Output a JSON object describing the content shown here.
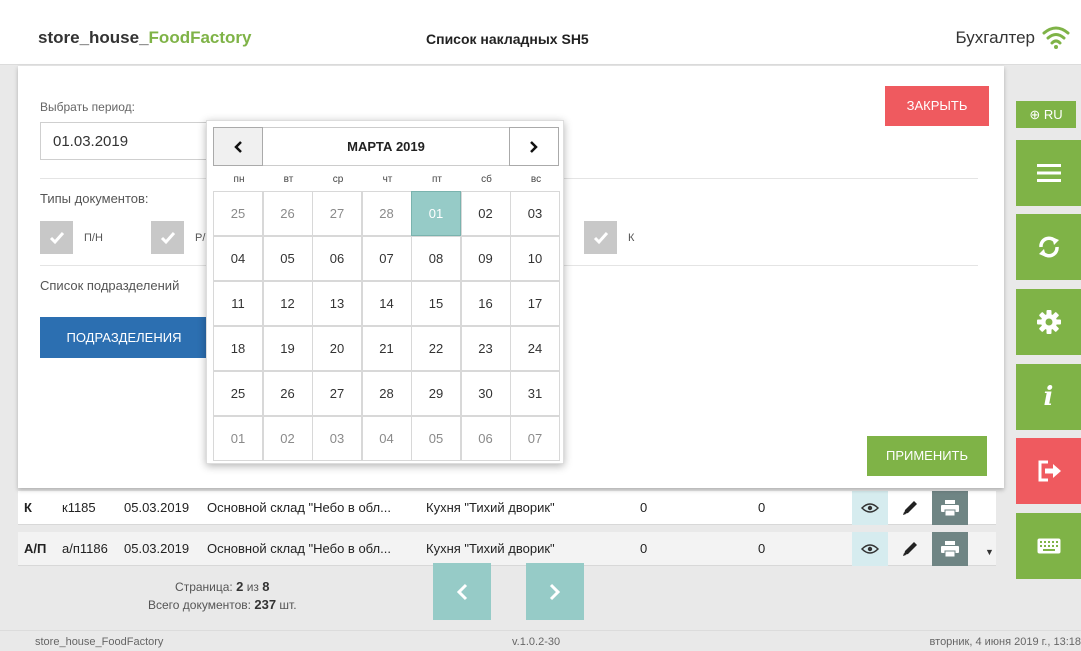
{
  "header": {
    "brand_main": "store_house_",
    "brand_accent": "FoodFactory",
    "title": "Список накладных SH5",
    "role": "Бухгалтер"
  },
  "sidebar": {
    "lang": "⊕ RU",
    "buttons": [
      {
        "icon": "menu-icon",
        "color": "#7fb347"
      },
      {
        "icon": "sync-icon",
        "color": "#7fb347"
      },
      {
        "icon": "gear-icon",
        "color": "#7fb347"
      },
      {
        "icon": "info-icon",
        "color": "#7fb347"
      },
      {
        "icon": "logout-icon",
        "color": "#ef5a5f"
      },
      {
        "icon": "keyboard-icon",
        "color": "#7fb347"
      }
    ]
  },
  "filter_modal": {
    "period_label": "Выбрать период:",
    "period_value": "01.03.2019",
    "close_label": "ЗАКРЫТЬ",
    "doc_types_label": "Типы документов:",
    "doc_types": [
      {
        "label": "П/Н",
        "checked": true
      },
      {
        "label": "Р/",
        "checked": true
      },
      {
        "label": "К",
        "checked": true
      }
    ],
    "subdivisions_label": "Список подразделений",
    "subdivisions_button": "ПОДРАЗДЕЛЕНИЯ",
    "apply_label": "ПРИМЕНИТЬ"
  },
  "calendar": {
    "month_label": "МАРТА 2019",
    "weekdays": [
      "пн",
      "вт",
      "ср",
      "чт",
      "пт",
      "сб",
      "вс"
    ],
    "weeks": [
      [
        "25",
        "26",
        "27",
        "28",
        "01",
        "02",
        "03"
      ],
      [
        "04",
        "05",
        "06",
        "07",
        "08",
        "09",
        "10"
      ],
      [
        "11",
        "12",
        "13",
        "14",
        "15",
        "16",
        "17"
      ],
      [
        "18",
        "19",
        "20",
        "21",
        "22",
        "23",
        "24"
      ],
      [
        "25",
        "26",
        "27",
        "28",
        "29",
        "30",
        "31"
      ],
      [
        "01",
        "02",
        "03",
        "04",
        "05",
        "06",
        "07"
      ]
    ],
    "selected": "01"
  },
  "table": {
    "rows": [
      {
        "type": "К",
        "number": "к1185",
        "date": "05.03.2019",
        "from": "Основной склад \"Небо в обл...",
        "to": "Кухня \"Тихий дворик\"",
        "v1": "0",
        "v2": "0"
      },
      {
        "type": "А/П",
        "number": "а/п1186",
        "date": "05.03.2019",
        "from": "Основной склад \"Небо в обл...",
        "to": "Кухня \"Тихий дворик\"",
        "v1": "0",
        "v2": "0"
      }
    ]
  },
  "pager": {
    "page_prefix": "Страница:",
    "page_current": "2",
    "page_of": "из",
    "page_total": "8",
    "docs_prefix": "Всего документов:",
    "docs_count": "237",
    "docs_suffix": "шт."
  },
  "footer": {
    "left": "store_house_FoodFactory",
    "version": "v.1.0.2-30",
    "datetime": "вторник, 4 июня 2019 г., 13:18"
  },
  "colors": {
    "accent_green": "#7fb347",
    "danger_red": "#ef5a5f",
    "primary_blue": "#2c6fb1",
    "teal": "#96cbc7"
  }
}
